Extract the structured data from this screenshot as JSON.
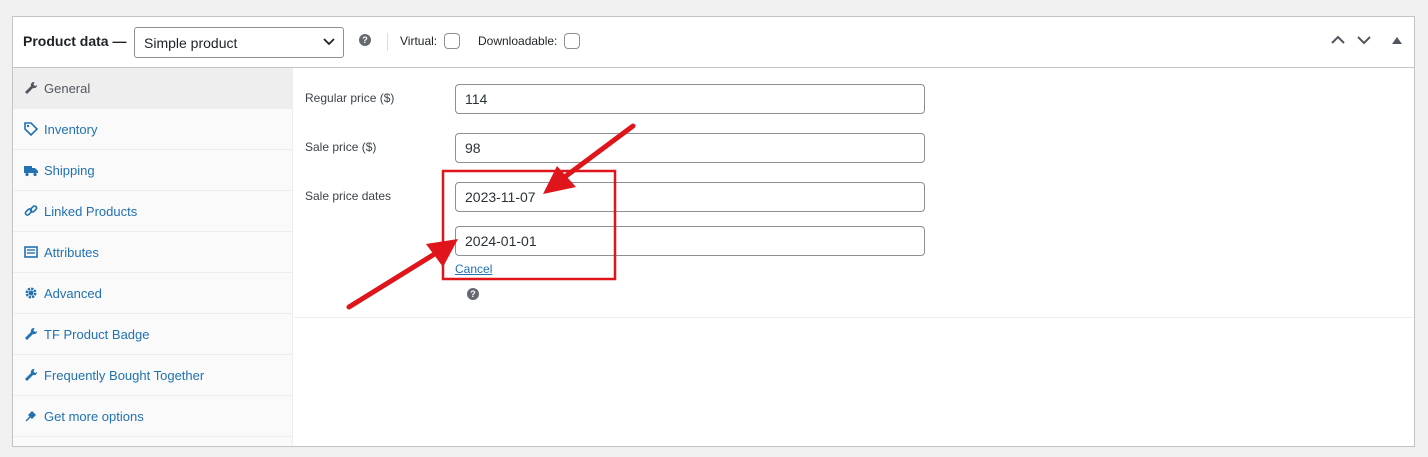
{
  "header": {
    "title": "Product data —",
    "product_type": "Simple product",
    "virtual_label": "Virtual:",
    "virtual_checked": false,
    "downloadable_label": "Downloadable:",
    "downloadable_checked": false,
    "help_glyph": "?"
  },
  "tabs": [
    {
      "label": "General",
      "icon": "wrench-icon",
      "active": true
    },
    {
      "label": "Inventory",
      "icon": "tag-icon",
      "active": false
    },
    {
      "label": "Shipping",
      "icon": "truck-icon",
      "active": false
    },
    {
      "label": "Linked Products",
      "icon": "link-icon",
      "active": false
    },
    {
      "label": "Attributes",
      "icon": "list-icon",
      "active": false
    },
    {
      "label": "Advanced",
      "icon": "gear-icon",
      "active": false
    },
    {
      "label": "TF Product Badge",
      "icon": "wrench-icon",
      "active": false
    },
    {
      "label": "Frequently Bought Together",
      "icon": "wrench-icon",
      "active": false
    },
    {
      "label": "Get more options",
      "icon": "plugin-icon",
      "active": false
    }
  ],
  "general": {
    "regular_price_label": "Regular price ($)",
    "regular_price_value": "114",
    "sale_price_label": "Sale price ($)",
    "sale_price_value": "98",
    "sale_dates_label": "Sale price dates",
    "sale_date_from": "2023-11-07",
    "sale_date_to": "2024-01-01",
    "cancel_label": "Cancel"
  },
  "annotation": {
    "highlight_color": "#e0151b"
  }
}
